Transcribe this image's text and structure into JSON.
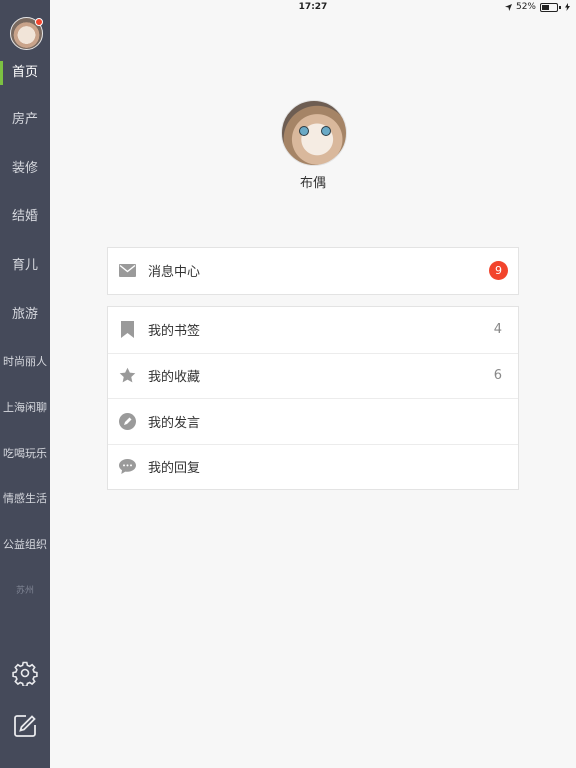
{
  "status_bar": {
    "time": "17:27",
    "battery": "52%",
    "battery_level": 0.52
  },
  "sidebar": {
    "items": [
      {
        "label": "首页",
        "active": true
      },
      {
        "label": "房产"
      },
      {
        "label": "装修"
      },
      {
        "label": "结婚"
      },
      {
        "label": "育儿"
      },
      {
        "label": "旅游"
      },
      {
        "label": "时尚丽人"
      },
      {
        "label": "上海闲聊"
      },
      {
        "label": "吃喝玩乐"
      },
      {
        "label": "情感生活"
      },
      {
        "label": "公益组织"
      },
      {
        "label": "苏州"
      }
    ],
    "settings_icon": "gear-icon",
    "compose_icon": "compose-icon"
  },
  "profile": {
    "name": "布偶"
  },
  "messages": {
    "label": "消息中心",
    "badge": "9",
    "icon": "envelope-icon"
  },
  "menu": [
    {
      "label": "我的书签",
      "count": "4",
      "icon": "bookmark-icon"
    },
    {
      "label": "我的收藏",
      "count": "6",
      "icon": "star-icon"
    },
    {
      "label": "我的发言",
      "count": "",
      "icon": "pencil-icon"
    },
    {
      "label": "我的回复",
      "count": "",
      "icon": "chat-bubble-icon"
    }
  ],
  "colors": {
    "sidebar_bg": "#454a5a",
    "active_indicator": "#7cc142",
    "badge_red": "#f2442c",
    "icon_gray": "#9a9a9a"
  }
}
